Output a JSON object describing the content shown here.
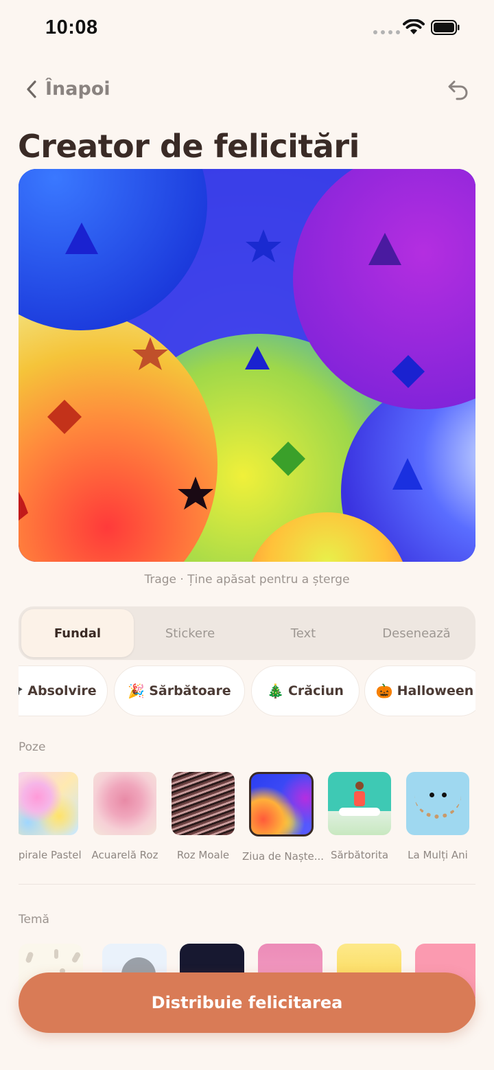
{
  "status": {
    "time": "10:08"
  },
  "nav": {
    "back_label": "Înapoi"
  },
  "title": "Creator de felicitări",
  "hint": "Trage · Ține apăsat pentru a șterge",
  "tabs": [
    {
      "label": "Fundal",
      "active": true
    },
    {
      "label": "Stickere",
      "active": false
    },
    {
      "label": "Text",
      "active": false
    },
    {
      "label": "Desenează",
      "active": false
    }
  ],
  "categories": [
    {
      "icon": "🎓",
      "label": "Absolvire"
    },
    {
      "icon": "🎉",
      "label": "Sărbătoare"
    },
    {
      "icon": "🎄",
      "label": "Crăciun"
    },
    {
      "icon": "🎃",
      "label": "Halloween"
    }
  ],
  "photos_section": {
    "label": "Poze"
  },
  "photos": [
    {
      "caption": "Spirale Pastel",
      "selected": false
    },
    {
      "caption": "Acuarelă Roz",
      "selected": false
    },
    {
      "caption": "Roz Moale",
      "selected": false
    },
    {
      "caption": "Ziua de Naște...",
      "selected": true
    },
    {
      "caption": "Sărbătorita",
      "selected": false
    },
    {
      "caption": "La Mulți Ani",
      "selected": false
    }
  ],
  "theme_section": {
    "label": "Temă"
  },
  "share_button": {
    "label": "Distribuie felicitarea"
  },
  "colors": {
    "accent": "#D97B56",
    "background": "#FCF6F1",
    "title": "#3A2B26"
  }
}
